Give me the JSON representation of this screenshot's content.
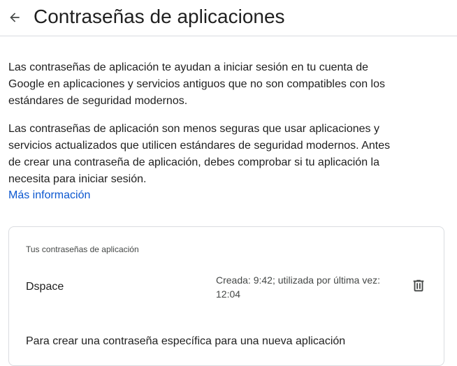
{
  "header": {
    "back_icon": "arrow-back-icon",
    "title": "Contraseñas de aplicaciones"
  },
  "intro": {
    "paragraph_1": "Las contraseñas de aplicación te ayudan a iniciar sesión en tu cuenta de Google en aplicaciones y servicios antiguos que no son compatibles con los estándares de seguridad modernos.",
    "paragraph_2": "Las contraseñas de aplicación son menos seguras que usar aplicaciones y servicios actualizados que utilicen estándares de seguridad modernos. Antes de crear una contraseña de aplicación, debes comprobar si tu aplicación la necesita para iniciar sesión.",
    "link": "Más información"
  },
  "card": {
    "label": "Tus contraseñas de aplicación",
    "items": [
      {
        "name": "Dspace",
        "meta": "Creada: 9:42; utilizada por última vez: 12:04",
        "delete_icon": "trash-icon"
      }
    ],
    "truncated_text": "Para crear una contraseña específica para una nueva aplicación"
  },
  "colors": {
    "link": "#0b57d0",
    "text": "#1f1f1f",
    "secondary_text": "#444746",
    "border": "#dadce0"
  }
}
